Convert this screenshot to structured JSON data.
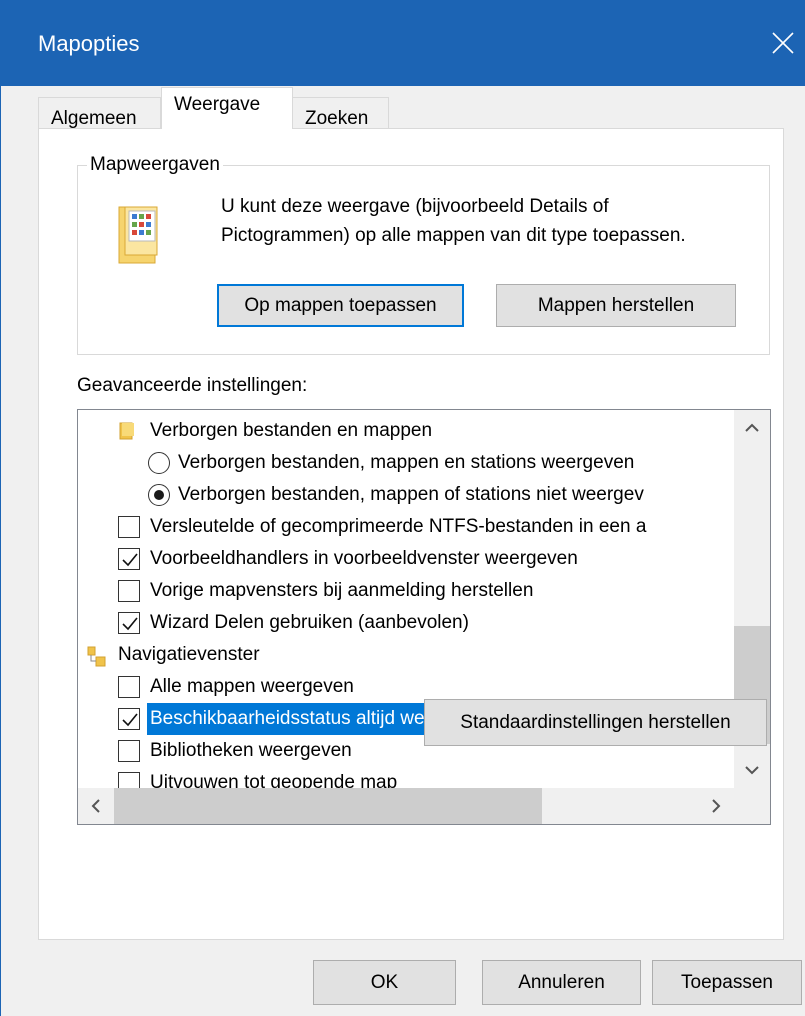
{
  "window": {
    "title": "Mapopties",
    "accent_color": "#1c64b4",
    "close_icon": "close-icon"
  },
  "tabs": [
    {
      "label": "Algemeen",
      "active": false
    },
    {
      "label": "Weergave",
      "active": true
    },
    {
      "label": "Zoeken",
      "active": false
    }
  ],
  "folder_views": {
    "legend": "Mapweergaven",
    "description": "U kunt deze weergave (bijvoorbeeld Details of Pictogrammen) op alle mappen van dit type toepassen.",
    "icon": "folder-views-icon",
    "apply_button": "Op mappen toepassen",
    "reset_button": "Mappen herstellen"
  },
  "advanced": {
    "label": "Geavanceerde instellingen:",
    "items": [
      {
        "type": "folder",
        "text": "Verborgen bestanden en mappen"
      },
      {
        "type": "radio",
        "text": "Verborgen bestanden, mappen en stations weergeven",
        "checked": false
      },
      {
        "type": "radio",
        "text": "Verborgen bestanden, mappen of stations niet weergev",
        "checked": true
      },
      {
        "type": "checkbox",
        "text": "Versleutelde of gecomprimeerde NTFS-bestanden in een a",
        "checked": false
      },
      {
        "type": "checkbox",
        "text": "Voorbeeldhandlers in voorbeeldvenster weergeven",
        "checked": true
      },
      {
        "type": "checkbox",
        "text": "Vorige mapvensters bij aanmelding herstellen",
        "checked": false
      },
      {
        "type": "checkbox",
        "text": "Wizard Delen gebruiken (aanbevolen)",
        "checked": true
      },
      {
        "type": "nav",
        "text": "Navigatievenster"
      },
      {
        "type": "checkbox",
        "text": "Alle mappen weergeven",
        "checked": false
      },
      {
        "type": "checkbox",
        "text": "Beschikbaarheidsstatus altijd weergeven",
        "checked": true,
        "selected": true
      },
      {
        "type": "checkbox",
        "text": "Bibliotheken weergeven",
        "checked": false
      },
      {
        "type": "checkbox",
        "text": "Uitvouwen tot geopende map",
        "checked": false
      }
    ]
  },
  "restore_defaults_button": "Standaardinstellingen herstellen",
  "footer": {
    "ok": "OK",
    "cancel": "Annuleren",
    "apply": "Toepassen"
  }
}
